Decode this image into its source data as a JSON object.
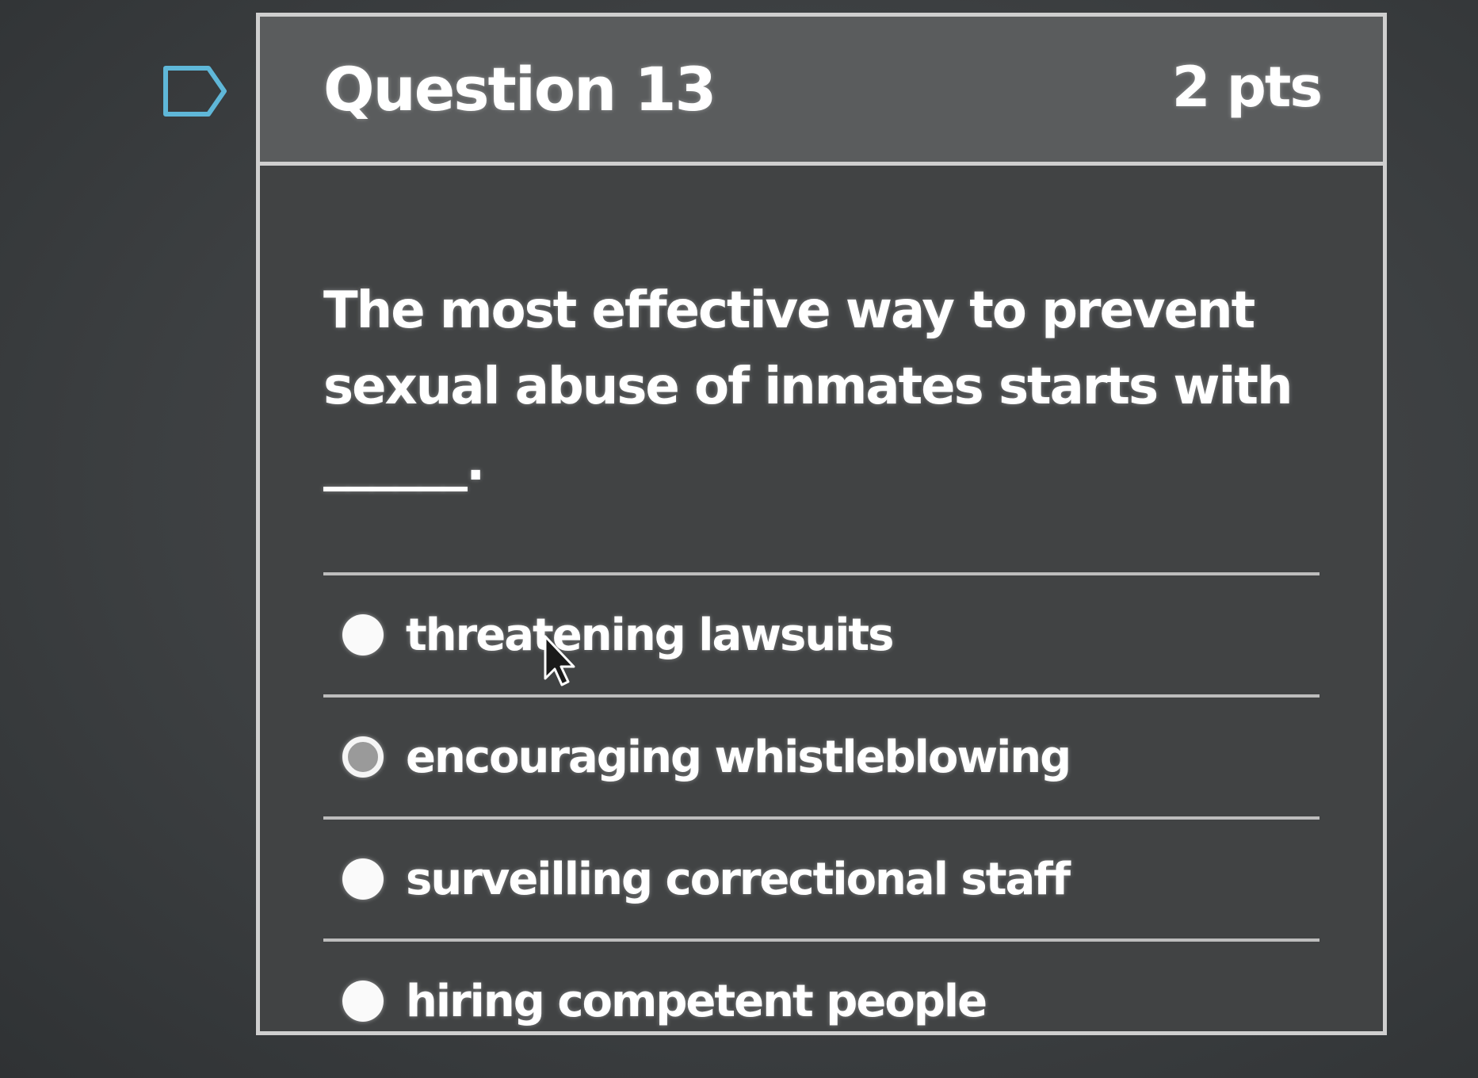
{
  "question": {
    "title": "Question 13",
    "points": "2 pts",
    "text": "The most effective way to prevent sexual abuse of inmates starts with ______.",
    "flag_icon": "flag-icon"
  },
  "answers": [
    {
      "label": "threatening lawsuits",
      "hovered": false
    },
    {
      "label": "encouraging whistleblowing",
      "hovered": true
    },
    {
      "label": "surveilling correctional staff",
      "hovered": false
    },
    {
      "label": "hiring competent people",
      "hovered": false
    }
  ],
  "colors": {
    "background": "#3d4042",
    "card_header": "#5a5c5d",
    "card_border": "#cfcfcf",
    "text": "#ffffff"
  }
}
